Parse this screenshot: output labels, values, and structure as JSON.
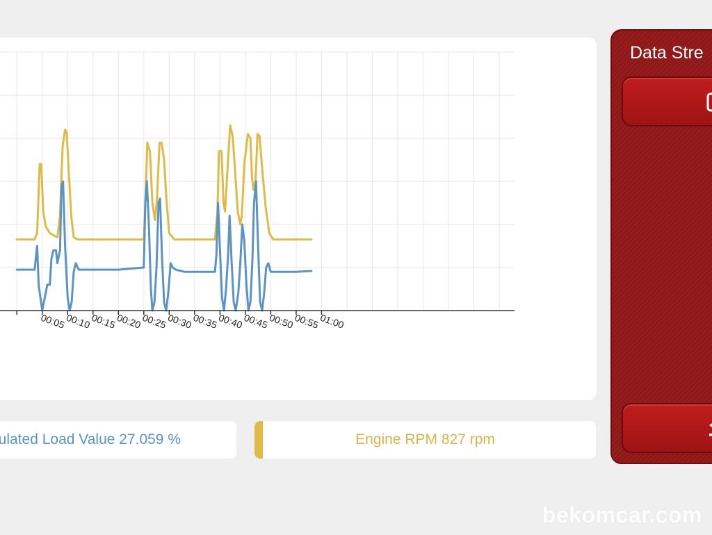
{
  "side_panel": {
    "title": "Data Stre",
    "top_button_icon": "graph-view-icon",
    "bottom_button_icon": "back-arrow-icon"
  },
  "legend": {
    "load_text": "ulated Load Value 27.059 %",
    "rpm_text": "Engine RPM 827 rpm"
  },
  "watermark": "bekomcar.com",
  "colors": {
    "load": "#5a93c4",
    "rpm": "#dfba48",
    "panel": "#8f1717"
  },
  "chart_data": {
    "type": "line",
    "x_ticks": [
      "00:05",
      "00:10",
      "00:15",
      "00:20",
      "00:25",
      "00:30",
      "00:35",
      "00:40",
      "00:45",
      "00:50",
      "00:55",
      "01:00"
    ],
    "x_range": [
      -0.04,
      0.98
    ],
    "y_range": [
      0,
      6
    ],
    "grid": true,
    "series": [
      {
        "color": "#dfba48",
        "points": [
          [
            0,
            1.65
          ],
          [
            0.02,
            1.65
          ],
          [
            0.035,
            1.65
          ],
          [
            0.04,
            1.8
          ],
          [
            0.045,
            3.4
          ],
          [
            0.048,
            3.4
          ],
          [
            0.052,
            2.3
          ],
          [
            0.057,
            1.95
          ],
          [
            0.065,
            1.8
          ],
          [
            0.072,
            1.75
          ],
          [
            0.08,
            1.7
          ],
          [
            0.085,
            2.2
          ],
          [
            0.09,
            3.8
          ],
          [
            0.095,
            4.2
          ],
          [
            0.098,
            4.15
          ],
          [
            0.102,
            3.3
          ],
          [
            0.107,
            2.2
          ],
          [
            0.112,
            1.7
          ],
          [
            0.12,
            1.65
          ],
          [
            0.2,
            1.65
          ],
          [
            0.25,
            1.65
          ],
          [
            0.253,
            2.5
          ],
          [
            0.257,
            3.9
          ],
          [
            0.262,
            3.7
          ],
          [
            0.267,
            2.5
          ],
          [
            0.272,
            2.1
          ],
          [
            0.276,
            2.6
          ],
          [
            0.281,
            3.9
          ],
          [
            0.285,
            3.9
          ],
          [
            0.29,
            3.5
          ],
          [
            0.295,
            2.5
          ],
          [
            0.3,
            1.8
          ],
          [
            0.31,
            1.65
          ],
          [
            0.35,
            1.65
          ],
          [
            0.39,
            1.65
          ],
          [
            0.395,
            2.3
          ],
          [
            0.398,
            3.7
          ],
          [
            0.403,
            3.7
          ],
          [
            0.407,
            2.5
          ],
          [
            0.41,
            2.3
          ],
          [
            0.415,
            3.3
          ],
          [
            0.42,
            4.3
          ],
          [
            0.425,
            4.05
          ],
          [
            0.43,
            3.2
          ],
          [
            0.435,
            2.3
          ],
          [
            0.44,
            2.0
          ],
          [
            0.443,
            2.2
          ],
          [
            0.448,
            3.4
          ],
          [
            0.455,
            4.1
          ],
          [
            0.46,
            4.0
          ],
          [
            0.463,
            3.1
          ],
          [
            0.466,
            2.8
          ],
          [
            0.47,
            3.0
          ],
          [
            0.474,
            4.1
          ],
          [
            0.478,
            4.05
          ],
          [
            0.483,
            3.3
          ],
          [
            0.49,
            2.4
          ],
          [
            0.497,
            1.8
          ],
          [
            0.505,
            1.65
          ],
          [
            0.58,
            1.65
          ]
        ]
      },
      {
        "color": "#5a93c4",
        "points": [
          [
            0,
            0.95
          ],
          [
            0.03,
            0.95
          ],
          [
            0.035,
            0.95
          ],
          [
            0.04,
            1.5
          ],
          [
            0.043,
            0.6
          ],
          [
            0.05,
            0.0
          ],
          [
            0.055,
            0.3
          ],
          [
            0.06,
            0.6
          ],
          [
            0.065,
            0.6
          ],
          [
            0.068,
            1.2
          ],
          [
            0.072,
            1.4
          ],
          [
            0.077,
            1.4
          ],
          [
            0.08,
            1.1
          ],
          [
            0.085,
            1.4
          ],
          [
            0.088,
            2.9
          ],
          [
            0.091,
            3.0
          ],
          [
            0.095,
            1.5
          ],
          [
            0.1,
            0.3
          ],
          [
            0.104,
            0.0
          ],
          [
            0.108,
            0.2
          ],
          [
            0.112,
            0.9
          ],
          [
            0.116,
            1.1
          ],
          [
            0.122,
            0.95
          ],
          [
            0.2,
            0.95
          ],
          [
            0.25,
            1.0
          ],
          [
            0.253,
            2.5
          ],
          [
            0.256,
            3.0
          ],
          [
            0.26,
            2.0
          ],
          [
            0.264,
            0.5
          ],
          [
            0.267,
            0.0
          ],
          [
            0.271,
            0.2
          ],
          [
            0.275,
            1.0
          ],
          [
            0.279,
            2.5
          ],
          [
            0.282,
            2.6
          ],
          [
            0.286,
            1.2
          ],
          [
            0.29,
            0.2
          ],
          [
            0.294,
            0.0
          ],
          [
            0.298,
            0.4
          ],
          [
            0.303,
            1.1
          ],
          [
            0.307,
            1.0
          ],
          [
            0.313,
            0.95
          ],
          [
            0.33,
            0.9
          ],
          [
            0.36,
            0.9
          ],
          [
            0.39,
            0.9
          ],
          [
            0.393,
            1.3
          ],
          [
            0.396,
            2.5
          ],
          [
            0.4,
            1.4
          ],
          [
            0.404,
            0.3
          ],
          [
            0.408,
            0.0
          ],
          [
            0.412,
            0.5
          ],
          [
            0.416,
            1.3
          ],
          [
            0.419,
            2.2
          ],
          [
            0.423,
            1.1
          ],
          [
            0.427,
            0.2
          ],
          [
            0.431,
            0.0
          ],
          [
            0.436,
            0.4
          ],
          [
            0.44,
            1.1
          ],
          [
            0.444,
            2.0
          ],
          [
            0.448,
            1.6
          ],
          [
            0.452,
            0.6
          ],
          [
            0.456,
            0.0
          ],
          [
            0.46,
            0.2
          ],
          [
            0.464,
            1.2
          ],
          [
            0.467,
            2.5
          ],
          [
            0.471,
            3.0
          ],
          [
            0.475,
            1.5
          ],
          [
            0.479,
            0.2
          ],
          [
            0.483,
            0.0
          ],
          [
            0.487,
            0.4
          ],
          [
            0.491,
            1.0
          ],
          [
            0.495,
            1.1
          ],
          [
            0.5,
            0.9
          ],
          [
            0.508,
            0.9
          ],
          [
            0.55,
            0.9
          ],
          [
            0.58,
            0.92
          ]
        ]
      }
    ]
  }
}
